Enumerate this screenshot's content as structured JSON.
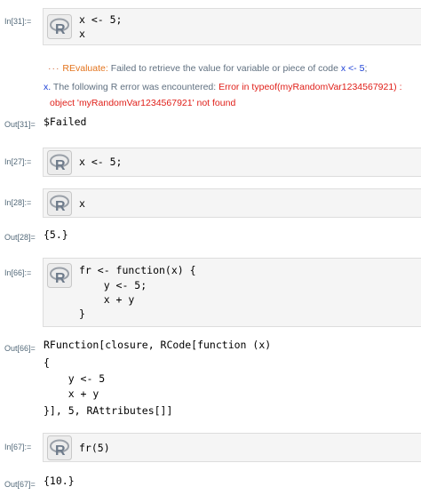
{
  "colors": {
    "label": "#546a7a",
    "cell_bg": "#f5f5f5",
    "error_red": "#e0201a",
    "link_blue": "#1b3fd6",
    "message_orange": "#e3731c"
  },
  "icons": {
    "r_logo": "r-logo-icon"
  },
  "cells": {
    "in31": {
      "label": "In[31]:=",
      "line1": "x <- 5;",
      "line2": "x"
    },
    "msg1": {
      "dots": "···",
      "tag": "REvaluate:",
      "text": "Failed to retrieve the value for variable or piece of code",
      "code": "x <- 5",
      "end": ";"
    },
    "msg2": {
      "prefix": "x.",
      "text": "The following R error was encountered:",
      "err1": "Error in typeof(myRandomVar1234567921) :",
      "err2": "object 'myRandomVar1234567921' not found"
    },
    "out31": {
      "label": "Out[31]=",
      "value": "$Failed"
    },
    "in27": {
      "label": "In[27]:=",
      "line1": "x <- 5;"
    },
    "in28": {
      "label": "In[28]:=",
      "line1": "x"
    },
    "out28": {
      "label": "Out[28]=",
      "value": "{5.}"
    },
    "in66": {
      "label": "In[66]:=",
      "line1": "fr <- function(x) {",
      "line2": "    y <- 5;",
      "line3": "    x + y",
      "line4": "}"
    },
    "out66": {
      "label": "Out[66]=",
      "line1": "RFunction[closure, RCode[function (x)",
      "line2": "{",
      "line3": "    y <- 5",
      "line4": "    x + y",
      "line5": "}], 5, RAttributes[]]"
    },
    "in67": {
      "label": "In[67]:=",
      "line1": "fr(5)"
    },
    "out67": {
      "label": "Out[67]=",
      "value": "{10.}"
    }
  }
}
